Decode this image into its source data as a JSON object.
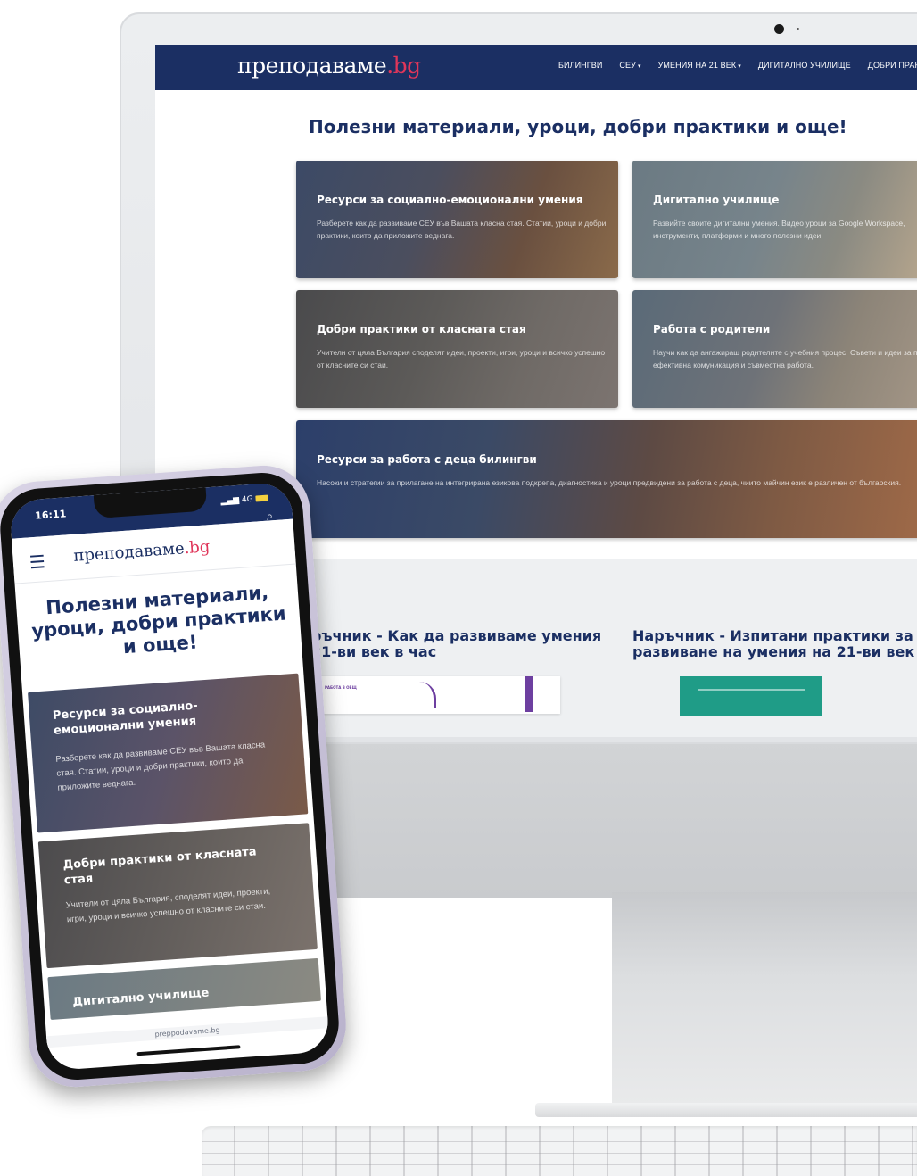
{
  "desktop": {
    "logo": {
      "main": "преподаваме",
      "suffix": ".bg"
    },
    "nav_items": [
      {
        "label": "БИЛИНГВИ",
        "dropdown": false
      },
      {
        "label": "СЕУ",
        "dropdown": true
      },
      {
        "label": "УМЕНИЯ НА 21 ВЕК",
        "dropdown": true
      },
      {
        "label": "ДИГИТАЛНО УЧИЛИЩЕ",
        "dropdown": false
      },
      {
        "label": "ДОБРИ ПРАКТ",
        "dropdown": false
      }
    ],
    "headline": "Полезни материали, уроци, добри практики и още!",
    "cards": [
      {
        "title": "Ресурси за социално-емоционални умения",
        "desc": "Разберете как да развиваме СЕУ във Вашата класна стая. Статии, уроци и добри практики, които да приложите веднага."
      },
      {
        "title": "Дигитално училище",
        "desc": "Развийте своите дигитални умения. Видео уроци за Google Workspace, инструменти, платформи и много полезни идеи."
      },
      {
        "title": "Добри практики от класната стая",
        "desc": "Учители от цяла България споделят идеи, проекти, игри, уроци и всичко успешно от класните си стаи."
      },
      {
        "title": "Работа с родители",
        "desc": "Научи как да ангажираш родителите с учебния процес. Съвети и идеи за по-ефективна комуникация и съвместна работа."
      },
      {
        "title": "Ресурси за работа с деца билингви",
        "desc": "Насоки и стратегии за прилагане на интегрирана езикова подкрепа, диагностика и уроци предвидени за работа с деца, чиито майчин език е различен от българския."
      }
    ],
    "handbooks": [
      {
        "title": "ръчник - Как да развиваме умения 21-ви век в час"
      },
      {
        "title": "Наръчник - Изпитани практики за развиване на умения на 21-ви век"
      }
    ],
    "handbook_thumb_label": "РАБОТА В ОБЩ"
  },
  "mobile": {
    "time": "16:11",
    "network": "4G",
    "logo": {
      "main": "преподаваме",
      "suffix": ".bg"
    },
    "headline": "Полезни материали, уроци, добри практики и още!",
    "cards": [
      {
        "title": "Ресурси за социално-емоционални умения",
        "desc": "Разберете как да развиваме СЕУ във Вашата класна стая. Статии, уроци и добри практики, които да приложите веднага."
      },
      {
        "title": "Добри практики от класната стая",
        "desc": "Учители от цяла България, споделят идеи, проекти, игри, уроци и всичко успешно от класните си стаи."
      },
      {
        "title": "Дигитално училище",
        "desc": ""
      }
    ],
    "url": "preppodavame.bg"
  },
  "colors": {
    "brand_navy": "#1b2f63",
    "brand_pink": "#e0365a",
    "handbook_green": "#1f9c87",
    "handbook_purple": "#6d3fa0"
  },
  "icons": [
    "hamburger-menu-icon",
    "search-icon",
    "caret-down-icon",
    "signal-icon",
    "battery-icon"
  ]
}
